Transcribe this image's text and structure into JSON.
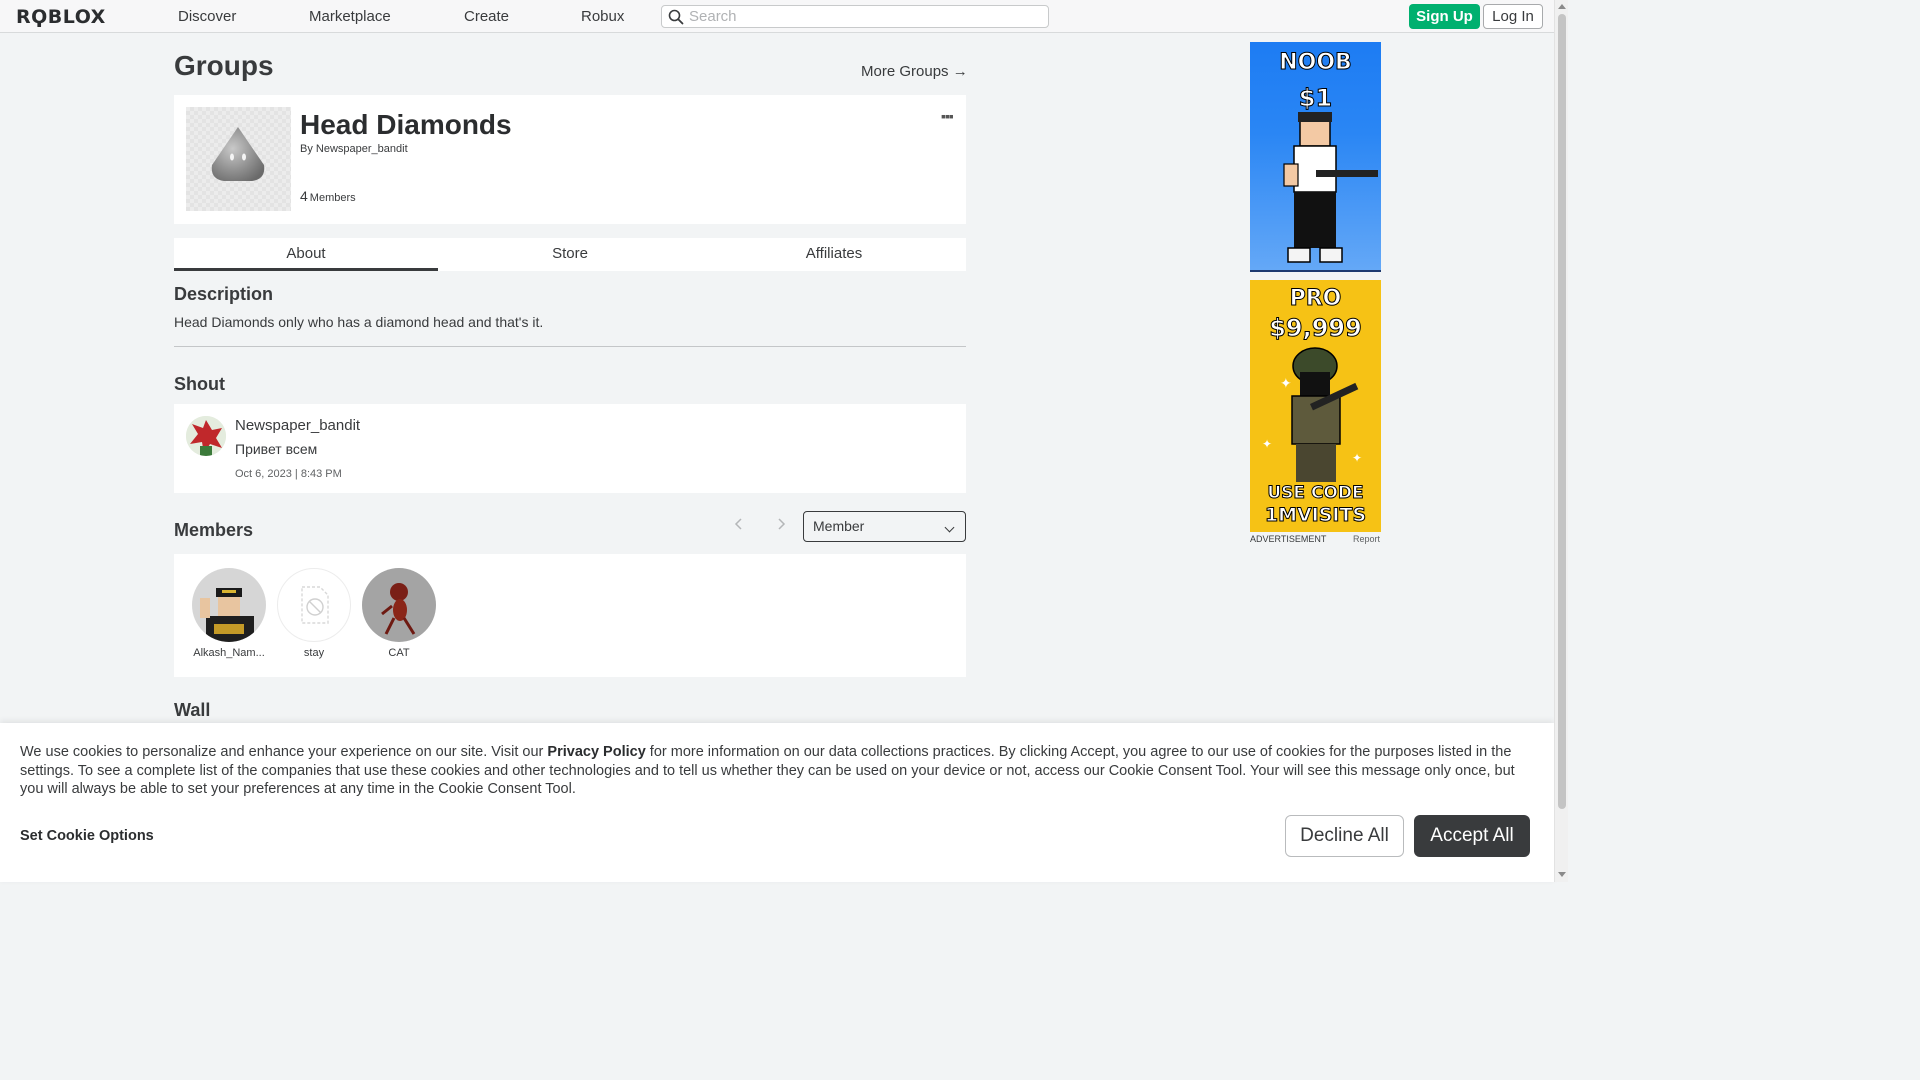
{
  "nav": {
    "logo": "RϘBLOX",
    "links": [
      "Discover",
      "Marketplace",
      "Create",
      "Robux"
    ],
    "search_placeholder": "Search",
    "signup": "Sign Up",
    "login": "Log In"
  },
  "page": {
    "title": "Groups",
    "more_groups": "More Groups →"
  },
  "group": {
    "name": "Head Diamonds",
    "by_label": "By",
    "owner": "Newspaper_bandit",
    "member_count": "4",
    "members_label": "Members",
    "more_icon": "more-dots-icon"
  },
  "tabs": [
    "About",
    "Store",
    "Affiliates"
  ],
  "description": {
    "heading": "Description",
    "text": "Head Diamonds only who has a diamond head and that's it."
  },
  "shout": {
    "heading": "Shout",
    "author": "Newspaper_bandit",
    "text": "Привет всем",
    "date": "Oct 6, 2023 | 8:43 PM"
  },
  "members": {
    "heading": "Members",
    "prev_icon": "chevron-left-icon",
    "next_icon": "chevron-right-icon",
    "role_filter": "Member",
    "list": [
      {
        "name": "Alkash_Nam..."
      },
      {
        "name": "stay"
      },
      {
        "name": "CAT"
      }
    ]
  },
  "wall": {
    "heading": "Wall"
  },
  "ads": {
    "ad1_line1": "NOOB",
    "ad1_line2": "$1",
    "ad2_line1": "PRO",
    "ad2_line2": "$9,999",
    "ad2_line3": "USE CODE",
    "ad2_line4": "1MVISITS",
    "label": "ADVERTISEMENT",
    "report": "Report"
  },
  "cookie": {
    "text_part1": "We use cookies to personalize and enhance your experience on our site. Visit our ",
    "privacy_link": "Privacy Policy",
    "text_part2": " for more information on our data collections practices. By clicking Accept, you agree to our use of cookies for the purposes listed in the settings. To see a complete list of the companies that use these cookies and other technologies and to tell us whether they can be used on your device or not, access our Cookie Consent Tool. Your will see this message only once, but you will always be able to set your preferences at any time in the Cookie Consent Tool.",
    "set_options": "Set Cookie Options",
    "decline": "Decline All",
    "accept": "Accept All"
  },
  "colors": {
    "signup_green": "#00b06f",
    "accent_dark": "#393b3d",
    "page_bg": "#f2f4f5"
  }
}
